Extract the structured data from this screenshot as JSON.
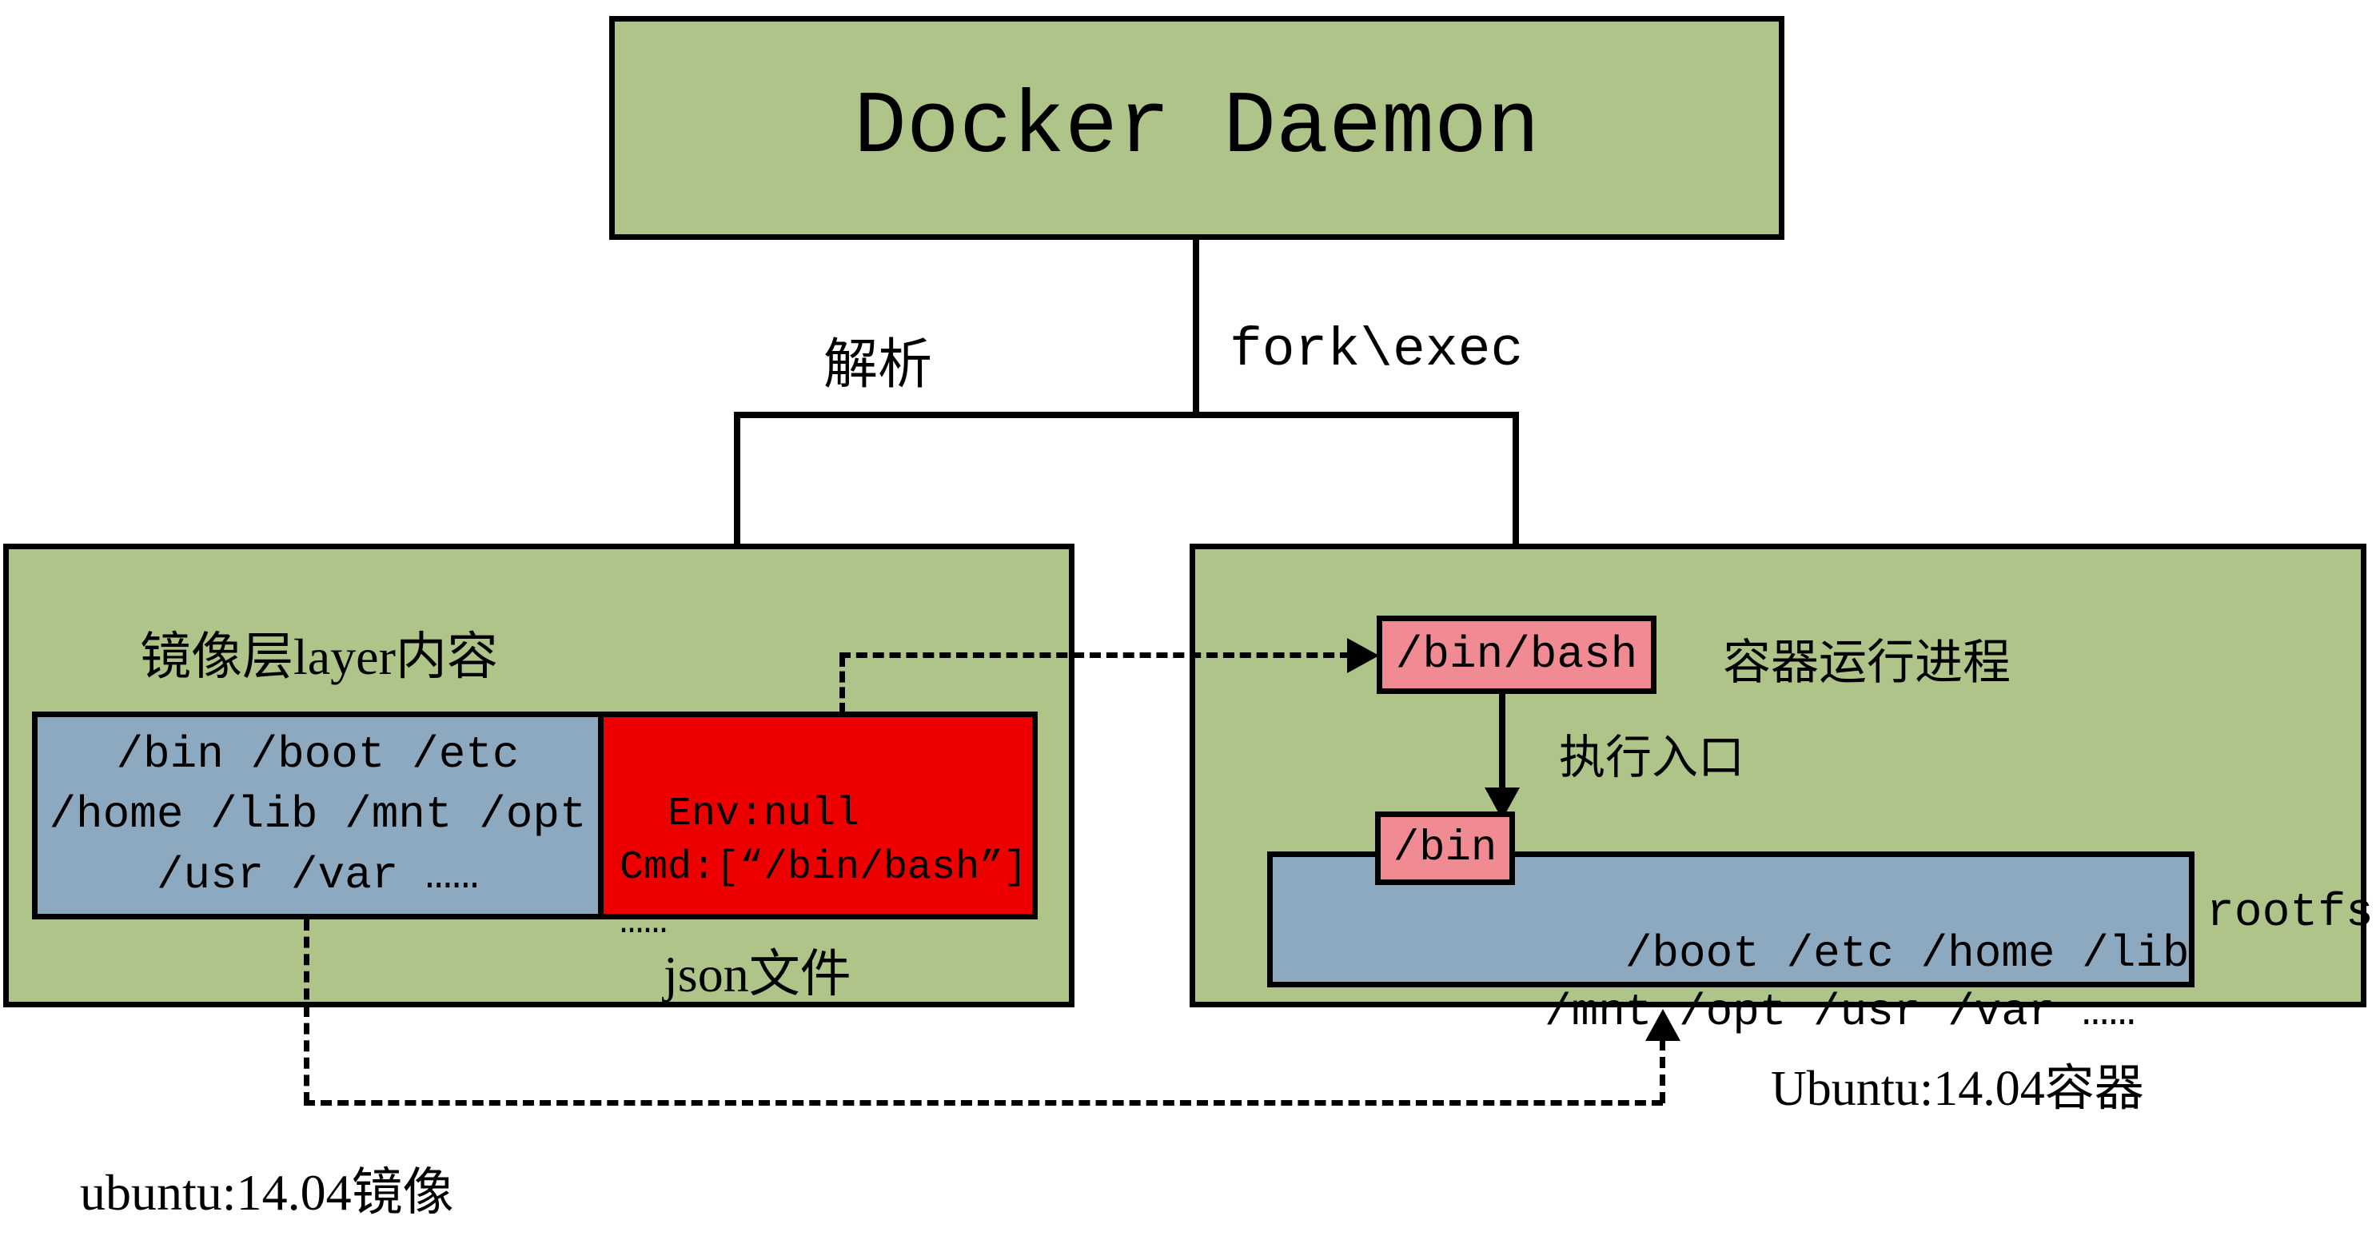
{
  "daemon": {
    "title": "Docker Daemon"
  },
  "labels": {
    "parse": "解析",
    "forkexec": "fork\\exec",
    "layer_title": "镜像层layer内容",
    "json_file": "json文件",
    "container_proc": "容器运行进程",
    "exec_entry": "执行入口",
    "rootfs": "rootfs",
    "image_caption": "ubuntu:14.04镜像",
    "container_caption": "Ubuntu:14.04容器"
  },
  "layer_dirs": "/bin /boot /etc\n/home /lib /mnt /opt\n/usr /var ……",
  "json_content": "Env:null\nCmd:[“/bin/bash”]\n……",
  "bin_bash": "/bin/bash",
  "bin": "/bin",
  "rootfs_dirs": " /boot /etc /home /lib\n/mnt /opt /usr /var ……"
}
